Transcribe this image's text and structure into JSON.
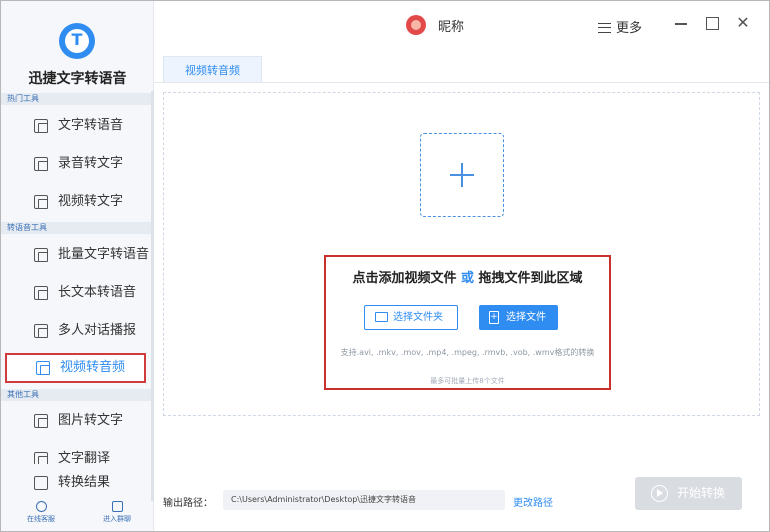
{
  "app": {
    "name": "迅捷文字转语音",
    "logo_letter": "T"
  },
  "header": {
    "nickname": "昵称",
    "more_label": "更多",
    "close_glyph": "✕"
  },
  "sidebar": {
    "sections": {
      "hot": "热门工具",
      "convert": "转语音工具",
      "other": "其他工具"
    },
    "items": [
      {
        "label": "文字转语音"
      },
      {
        "label": "录音转文字"
      },
      {
        "label": "视频转文字"
      },
      {
        "label": "批量文字转语音"
      },
      {
        "label": "长文本转语音"
      },
      {
        "label": "多人对话播报"
      },
      {
        "label": "视频转音频"
      },
      {
        "label": "图片转文字"
      },
      {
        "label": "文字翻译"
      }
    ],
    "results_label": "转换结果",
    "footer": {
      "support": "在线客服",
      "group": "进入群聊"
    }
  },
  "tabs": [
    {
      "label": "视频转音频",
      "active": true
    }
  ],
  "dropzone": {
    "title_prefix": "点击添加视频文件",
    "title_or": "或",
    "title_suffix": "拖拽文件到此区域",
    "select_folder_label": "选择文件夹",
    "select_file_label": "选择文件",
    "supported_formats": "支持.avi, .mkv, .mov, .mp4, .mpeg, .rmvb, .vob, .wmv格式的转换",
    "max_files": "最多可批量上传8个文件"
  },
  "output": {
    "label": "输出路径：",
    "path": "C:\\Users\\Administrator\\Desktop\\迅捷文字转语音",
    "change_label": "更改路径"
  },
  "start_label": "开始转换",
  "colors": {
    "accent": "#2f8cf0",
    "highlight_border": "#c9302c",
    "disabled": "#d9dce1"
  }
}
